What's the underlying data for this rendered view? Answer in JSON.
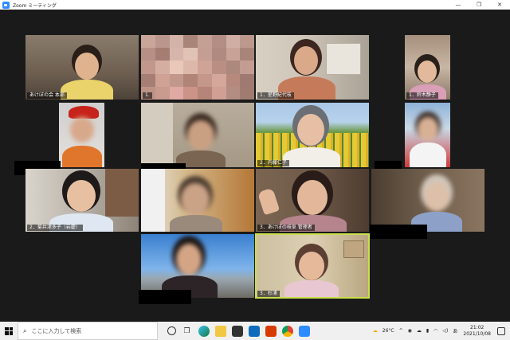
{
  "window": {
    "title": "Zoom ミーティング",
    "minimize": "—",
    "maximize": "❐",
    "close": "✕"
  },
  "participants": [
    {
      "id": "p1",
      "name": "あけぼの会 本部"
    },
    {
      "id": "p2",
      "name": "1."
    },
    {
      "id": "p3",
      "name": "1．星野紀代枝"
    },
    {
      "id": "p4",
      "name": "1．鈴木静子"
    },
    {
      "id": "p5",
      "name": ""
    },
    {
      "id": "p6",
      "name": ""
    },
    {
      "id": "p7",
      "name": "2．内藤仁子"
    },
    {
      "id": "p8",
      "name": ""
    },
    {
      "id": "p9",
      "name": "2．菊井津多子（岩慶）"
    },
    {
      "id": "p10",
      "name": ""
    },
    {
      "id": "p11",
      "name": "3．あけぼの岐阜 管理者"
    },
    {
      "id": "p12",
      "name": ""
    },
    {
      "id": "p13",
      "name": ""
    },
    {
      "id": "p14",
      "name": "3．杉浦"
    }
  ],
  "taskbar": {
    "search_placeholder": "ここに入力して検索",
    "weather": "26°C",
    "ime": "あ",
    "time": "21:02",
    "date": "2021/10/08"
  },
  "colors": {
    "active_speaker_border": "#c8e04a",
    "zoom_blue": "#2d8cff"
  },
  "icons": [
    "windows-start-icon",
    "search-icon",
    "cortana-icon",
    "task-view-icon",
    "edge-icon",
    "file-explorer-icon",
    "store-icon",
    "mail-icon",
    "office-icon",
    "chrome-icon",
    "zoom-icon"
  ]
}
